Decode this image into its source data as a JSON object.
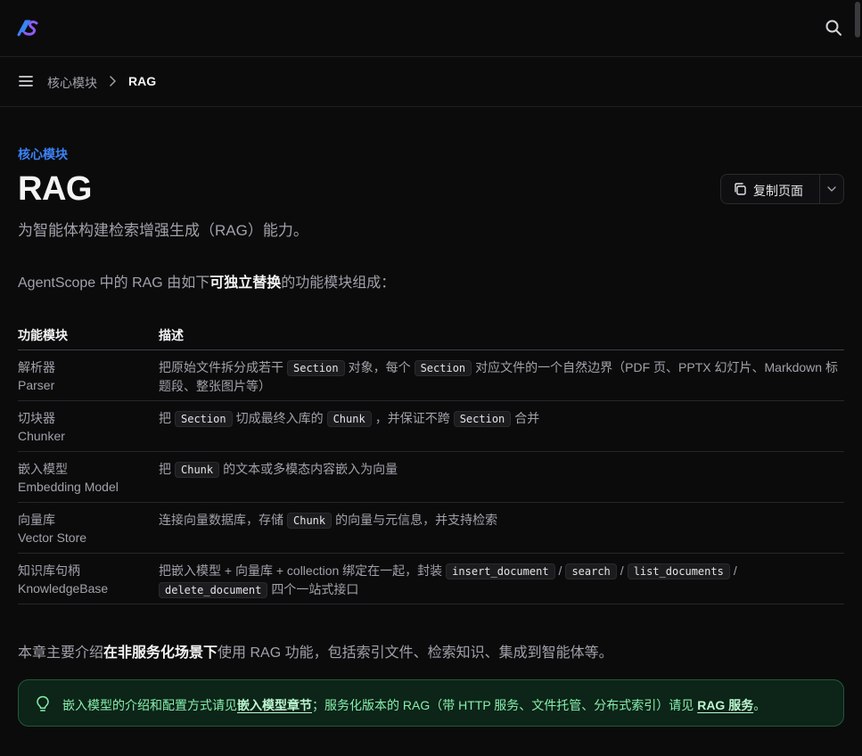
{
  "header": {
    "logo_text": "AS"
  },
  "breadcrumb": {
    "parent": "核心模块",
    "current": "RAG"
  },
  "page": {
    "section_label": "核心模块",
    "title": "RAG",
    "description": "为智能体构建检索增强生成（RAG）能力。",
    "copy_label": "复制页面"
  },
  "intro": {
    "before": "AgentScope 中的 RAG 由如下",
    "bold": "可独立替换",
    "after": "的功能模块组成："
  },
  "table": {
    "headers": [
      "功能模块",
      "描述"
    ],
    "rows": [
      {
        "name_zh": "解析器",
        "name_en": "Parser",
        "d": [
          "把原始文件拆分成若干",
          "Section",
          "对象，每个",
          "Section",
          "对应文件的一个自然边界（PDF 页、PPTX 幻灯片、Markdown 标题段、整张图片等）"
        ]
      },
      {
        "name_zh": "切块器",
        "name_en": "Chunker",
        "d": [
          "把",
          "Section",
          "切成最终入库的",
          "Chunk",
          "，并保证不跨",
          "Section",
          "合并"
        ]
      },
      {
        "name_zh": "嵌入模型",
        "name_en": "Embedding Model",
        "d": [
          "把",
          "Chunk",
          "的文本或多模态内容嵌入为向量"
        ]
      },
      {
        "name_zh": "向量库",
        "name_en": "Vector Store",
        "d": [
          "连接向量数据库，存储",
          "Chunk",
          "的向量与元信息，并支持检索"
        ]
      },
      {
        "name_zh": "知识库句柄",
        "name_en": "KnowledgeBase",
        "d": [
          "把嵌入模型 + 向量库 + collection 绑定在一起，封装",
          "insert_document",
          "/",
          "search",
          "/",
          "list_documents",
          "/",
          "delete_document",
          "四个一站式接口"
        ]
      }
    ]
  },
  "outro": {
    "before": "本章主要介绍",
    "bold": "在非服务化场景下",
    "after": "使用 RAG 功能，包括索引文件、检索知识、集成到智能体等。"
  },
  "callout": {
    "t1": "嵌入模型的介绍和配置方式请见",
    "link1": "嵌入模型章节",
    "t2": "；服务化版本的 RAG（带 HTTP 服务、文件托管、分布式索引）请见 ",
    "link2": "RAG 服务",
    "t3": "。"
  },
  "colors": {
    "accent": "#3b82f6",
    "callout_bg": "#0d2418",
    "callout_border": "#1f5a39",
    "callout_text": "#86efac"
  }
}
